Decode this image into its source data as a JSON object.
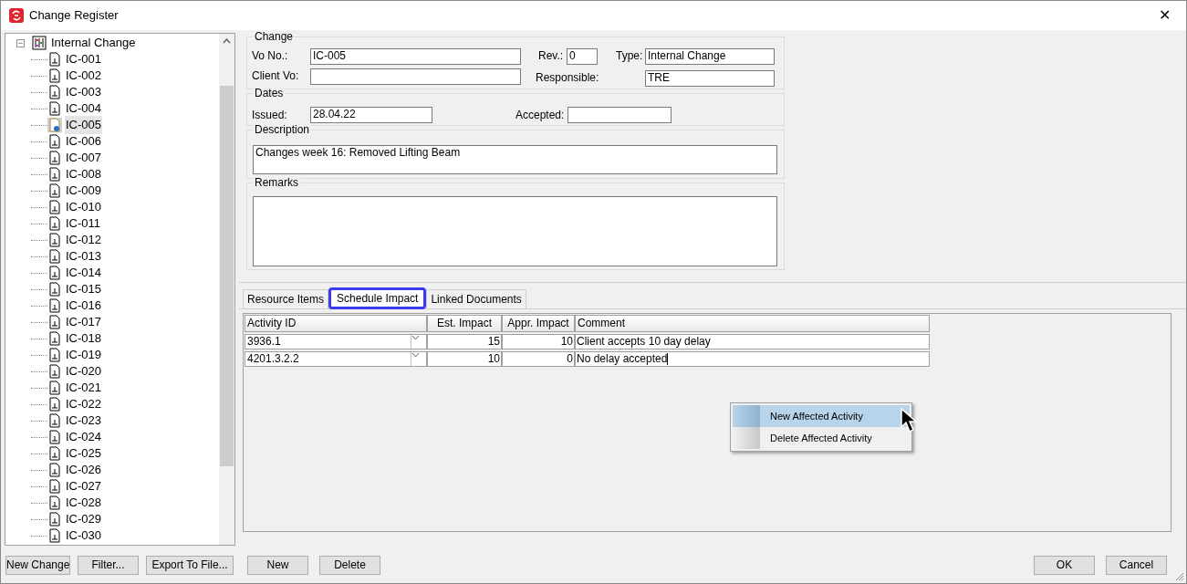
{
  "window": {
    "title": "Change Register",
    "close": "✕"
  },
  "tree": {
    "label": "Internal Change",
    "expanded": true,
    "expander": "−",
    "children": [
      {
        "label": "IC-001",
        "selected": false
      },
      {
        "label": "IC-002",
        "selected": false
      },
      {
        "label": "IC-003",
        "selected": false
      },
      {
        "label": "IC-004",
        "selected": false
      },
      {
        "label": "IC-005",
        "selected": true
      },
      {
        "label": "IC-006",
        "selected": false
      },
      {
        "label": "IC-007",
        "selected": false
      },
      {
        "label": "IC-008",
        "selected": false
      },
      {
        "label": "IC-009",
        "selected": false
      },
      {
        "label": "IC-010",
        "selected": false
      },
      {
        "label": "IC-011",
        "selected": false
      },
      {
        "label": "IC-012",
        "selected": false
      },
      {
        "label": "IC-013",
        "selected": false
      },
      {
        "label": "IC-014",
        "selected": false
      },
      {
        "label": "IC-015",
        "selected": false
      },
      {
        "label": "IC-016",
        "selected": false
      },
      {
        "label": "IC-017",
        "selected": false
      },
      {
        "label": "IC-018",
        "selected": false
      },
      {
        "label": "IC-019",
        "selected": false
      },
      {
        "label": "IC-020",
        "selected": false
      },
      {
        "label": "IC-021",
        "selected": false
      },
      {
        "label": "IC-022",
        "selected": false
      },
      {
        "label": "IC-023",
        "selected": false
      },
      {
        "label": "IC-024",
        "selected": false
      },
      {
        "label": "IC-025",
        "selected": false
      },
      {
        "label": "IC-026",
        "selected": false
      },
      {
        "label": "IC-027",
        "selected": false
      },
      {
        "label": "IC-028",
        "selected": false
      },
      {
        "label": "IC-029",
        "selected": false
      },
      {
        "label": "IC-030",
        "selected": false
      }
    ]
  },
  "change": {
    "title": "Change",
    "vo_no_label": "Vo No.:",
    "vo_no": "IC-005",
    "rev_label": "Rev.:",
    "rev": "0",
    "type_label": "Type:",
    "type": "Internal Change",
    "client_vo_label": "Client Vo:",
    "responsible_label": "Responsible:",
    "responsible": "TRE"
  },
  "dates": {
    "title": "Dates",
    "issued_label": "Issued:",
    "issued": "28.04.22",
    "accepted_label": "Accepted:"
  },
  "description": {
    "title": "Description",
    "value": "Changes week 16: Removed Lifting Beam"
  },
  "remarks": {
    "title": "Remarks"
  },
  "tabs": [
    {
      "label": "Resource Items",
      "selected": false
    },
    {
      "label": "Schedule Impact",
      "selected": true
    },
    {
      "label": "Linked Documents",
      "selected": false
    }
  ],
  "grid": {
    "columns": [
      "Activity ID",
      "Est. Impact",
      "Appr. Impact",
      "Comment"
    ],
    "rows": [
      {
        "activity_id": "3936.1",
        "est_impact": "15",
        "appr_impact": "10",
        "comment": "Client accepts 10 day delay",
        "editing": false
      },
      {
        "activity_id": "4201.3.2.2",
        "est_impact": "10",
        "appr_impact": "0",
        "comment": "No delay accepted",
        "editing": true
      }
    ]
  },
  "context_menu": [
    {
      "label": "New Affected Activity",
      "selected": true
    },
    {
      "label": "Delete Affected Activity",
      "selected": false
    }
  ],
  "buttons_left": [
    "New Change",
    "Filter...",
    "Export To File..."
  ],
  "buttons_mid": [
    "New",
    "Delete"
  ],
  "buttons_right": [
    "OK",
    "Cancel"
  ]
}
